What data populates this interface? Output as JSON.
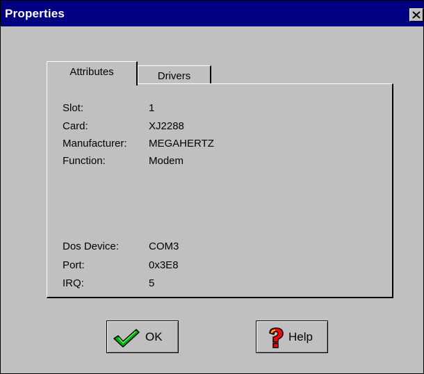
{
  "window": {
    "title": "Properties",
    "close_icon": "close-icon"
  },
  "tabs": [
    {
      "label": "Attributes",
      "selected": true
    },
    {
      "label": "Drivers",
      "selected": false
    }
  ],
  "attributes": {
    "slot": {
      "label": "Slot:",
      "value": "1"
    },
    "card": {
      "label": "Card:",
      "value": "XJ2288"
    },
    "manufacturer": {
      "label": "Manufacturer:",
      "value": "MEGAHERTZ"
    },
    "function": {
      "label": "Function:",
      "value": "Modem"
    },
    "dos_device": {
      "label": "Dos Device:",
      "value": "COM3"
    },
    "port": {
      "label": "Port:",
      "value": "0x3E8"
    },
    "irq": {
      "label": "IRQ:",
      "value": "5"
    }
  },
  "buttons": {
    "ok": {
      "label": "OK",
      "icon": "checkmark-icon"
    },
    "help": {
      "label": "Help",
      "icon": "question-mark-icon"
    }
  },
  "colors": {
    "title_bar": "#000080",
    "face": "#c0c0c0",
    "check_green": "#00b000",
    "help_red": "#ff0000",
    "help_yellow": "#ffff00"
  }
}
